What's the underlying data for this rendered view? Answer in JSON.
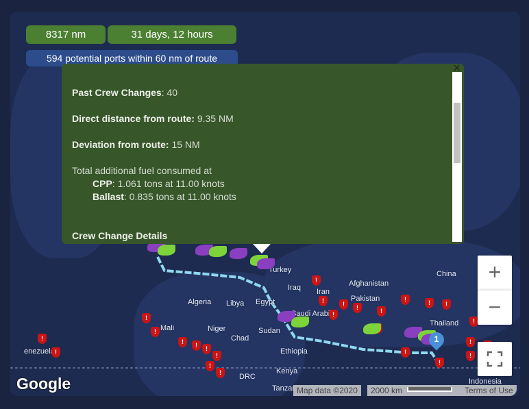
{
  "summary": {
    "distance": "8317 nm",
    "duration": "31 days, 12 hours",
    "ports": "594 potential ports within 60 nm of route"
  },
  "popup": {
    "past_crew_label": "Past Crew Changes",
    "past_crew_value": ": 40",
    "direct_label": "Direct distance from route:",
    "direct_value": " 9.35 NM",
    "deviation_label": "Deviation from route:",
    "deviation_value": " 15 NM",
    "fuel_intro": "Total additional fuel consumed at",
    "cpp_label": "CPP",
    "cpp_value": ": 1.061 tons at 11.00 knots",
    "ballast_label": "Ballast",
    "ballast_value": ": 0.835 tons at 11.00 knots",
    "details_heading": "Crew Change Details",
    "close": "×"
  },
  "map_labels": [
    "Turkey",
    "Iraq",
    "Iran",
    "Afghanistan",
    "Pakistan",
    "China",
    "Algeria",
    "Libya",
    "Egypt",
    "Saudi Arabia",
    "Mali",
    "Niger",
    "Chad",
    "Sudan",
    "Ethiopia",
    "Thailand",
    "enezuela",
    "Kenya",
    "DRC",
    "Tanzania",
    "Indonesia"
  ],
  "route_marker": "1",
  "controls": {
    "zoom_in": "+",
    "zoom_out": "−",
    "fullscreen": "fullscreen-icon"
  },
  "footer": {
    "logo": "Google",
    "map_data": "Map data ©2020",
    "scale": "2000 km",
    "terms": "Terms of Use"
  },
  "colors": {
    "route": "#8fd8f0",
    "pill_green": "#4b7f31",
    "pill_blue": "#2c4c8c",
    "popup_bg": "#37572a",
    "warning": "#cc1414",
    "port_green": "#7dd33a",
    "port_purple": "#8a3fc0"
  }
}
